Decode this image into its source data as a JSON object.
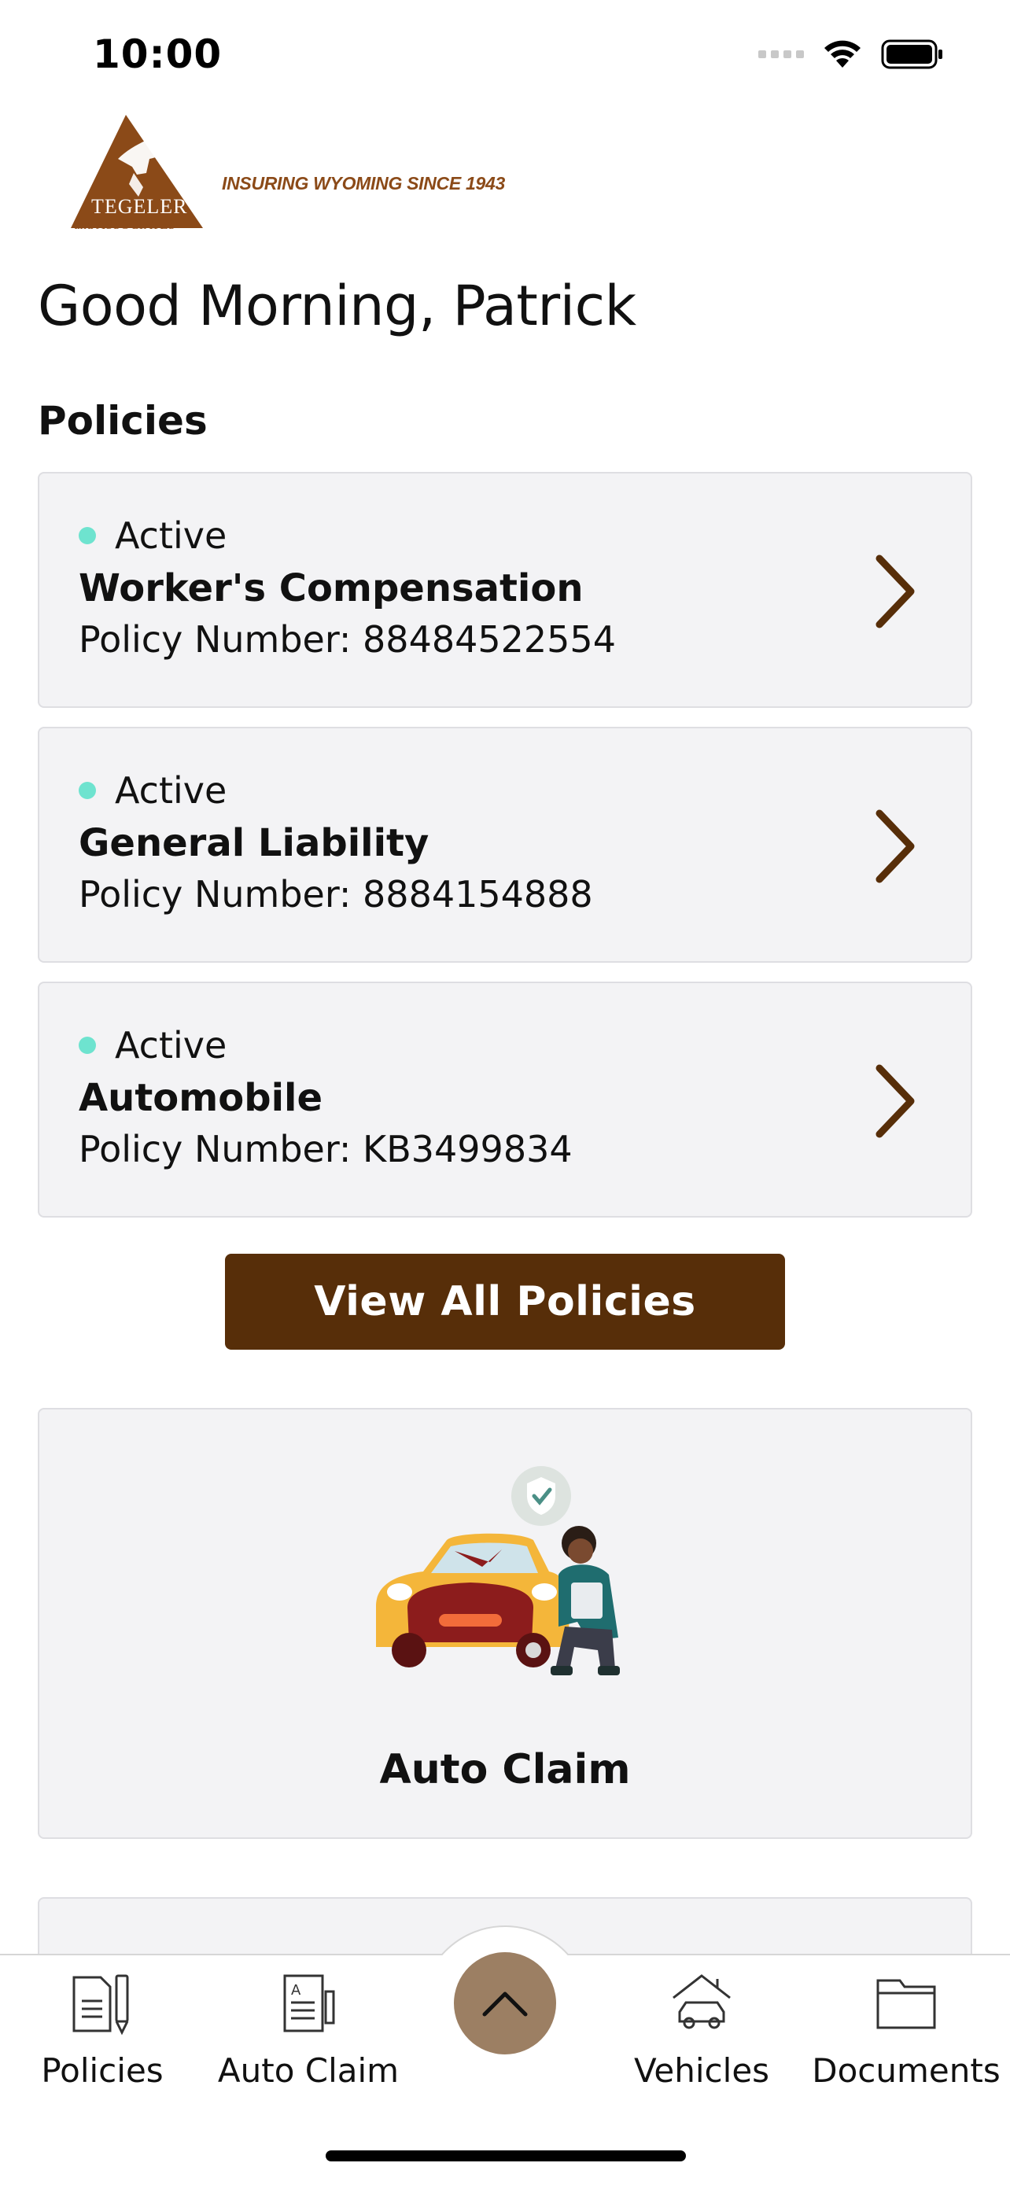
{
  "status_bar": {
    "time": "10:00"
  },
  "brand": {
    "tagline": "INSURING WYOMING SINCE 1943",
    "name": "TEGELER",
    "sub": "and ASSOCIATES",
    "colors": {
      "brown": "#572e09",
      "logo_brown": "#8b4a18"
    }
  },
  "greeting": "Good Morning, Patrick",
  "policies": {
    "title": "Policies",
    "items": [
      {
        "status": "Active",
        "name": "Worker's Compensation",
        "number": "Policy Number: 88484522554"
      },
      {
        "status": "Active",
        "name": "General Liability",
        "number": "Policy Number: 8884154888"
      },
      {
        "status": "Active",
        "name": "Automobile",
        "number": "Policy Number: KB3499834"
      }
    ],
    "view_all_label": "View All Policies",
    "status_color": "#6ee3cf"
  },
  "quick_actions": {
    "auto_claim_label": "Auto Claim"
  },
  "tab_bar": {
    "items": [
      {
        "label": "Policies",
        "icon": "policy-document-icon"
      },
      {
        "label": "Auto Claim",
        "icon": "claim-form-icon"
      },
      {
        "label": "Vehicles",
        "icon": "car-garage-icon"
      },
      {
        "label": "Documents",
        "icon": "folder-icon"
      }
    ],
    "center_icon": "chevron-up-icon",
    "center_color": "#9c7f63"
  }
}
